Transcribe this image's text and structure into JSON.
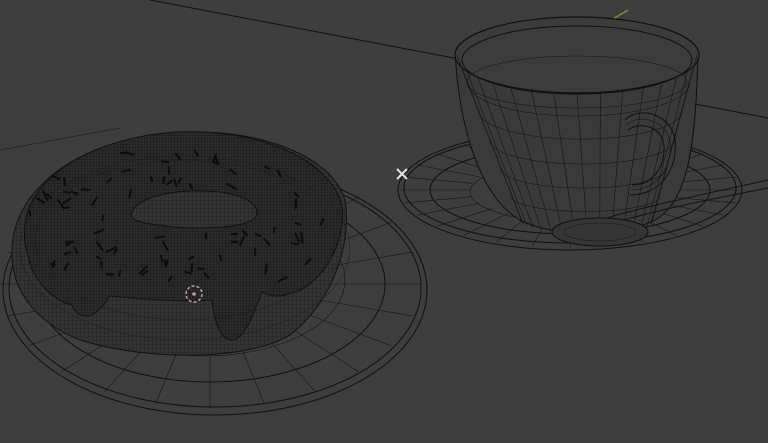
{
  "viewport": {
    "background_color": "#3e3e3e",
    "wire_color": "#0f0f0f",
    "icing_color": "#2a2a2a",
    "axis_color": "#6a9a3a",
    "cursor_color": "#d0d0d0",
    "origin_color": "#c79a9a"
  },
  "objects": [
    {
      "name": "donut",
      "type": "mesh",
      "mode": "wireframe"
    },
    {
      "name": "donut-plate",
      "type": "mesh",
      "mode": "wireframe"
    },
    {
      "name": "teacup",
      "type": "mesh",
      "mode": "wireframe"
    },
    {
      "name": "saucer",
      "type": "mesh",
      "mode": "wireframe"
    },
    {
      "name": "spoon",
      "type": "mesh",
      "mode": "wireframe"
    }
  ],
  "icons": {
    "cursor": "3d-cursor-icon",
    "origin": "object-origin-icon"
  }
}
